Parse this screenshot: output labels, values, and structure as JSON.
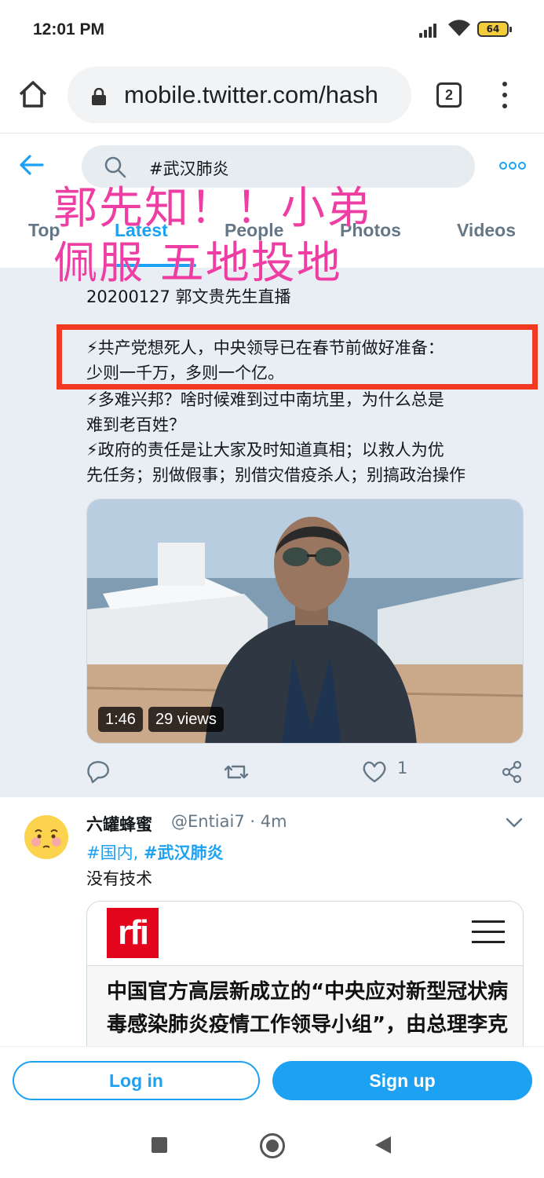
{
  "status_bar": {
    "time": "12:01 PM",
    "battery": "64"
  },
  "browser": {
    "url": "mobile.twitter.com/hash",
    "tab_count": "2"
  },
  "search": {
    "query": "#武汉肺炎"
  },
  "tabs": [
    {
      "label": "Top"
    },
    {
      "label": "Latest"
    },
    {
      "label": "People"
    },
    {
      "label": "Photos"
    },
    {
      "label": "Videos"
    }
  ],
  "overlay": {
    "line1": "郭先知！！小弟",
    "line2": "佩服 五地投地"
  },
  "tweet1": {
    "lines": [
      "20200127 郭文贵先生直播",
      "⚡共产党想死人，中央领导已在春节前做好准备：",
      "少则一千万，多则一个亿。",
      "⚡多难兴邦？啥时候难到过中南坑里，为什么总是",
      "难到老百姓？",
      "⚡政府的责任是让大家及时知道真相；以救人为优",
      "先任务；别做假事；别借灾借疫杀人；别搞政治操作"
    ],
    "video_duration": "1:46",
    "video_views": "29 views",
    "like_count": "1"
  },
  "tweet2": {
    "name": "六罐蜂蜜",
    "handle_time": "@Entiai7 · 4m",
    "hashtag1": "#国内",
    "sep": ", ",
    "hashtag2": "#武汉肺炎",
    "text": "没有技术",
    "card_logo": "rfi",
    "card_text": "中国官方高层新成立的“中央应对新型冠状病毒感染肺炎疫情工作领导小组”，由总理李克强担任组长，最高其首者汉可近"
  },
  "auth": {
    "login": "Log in",
    "signup": "Sign up"
  },
  "colors": {
    "twitter_blue": "#1da1f2",
    "overlay_pink": "#ee3ea3",
    "highlight_red": "#f23a22"
  }
}
